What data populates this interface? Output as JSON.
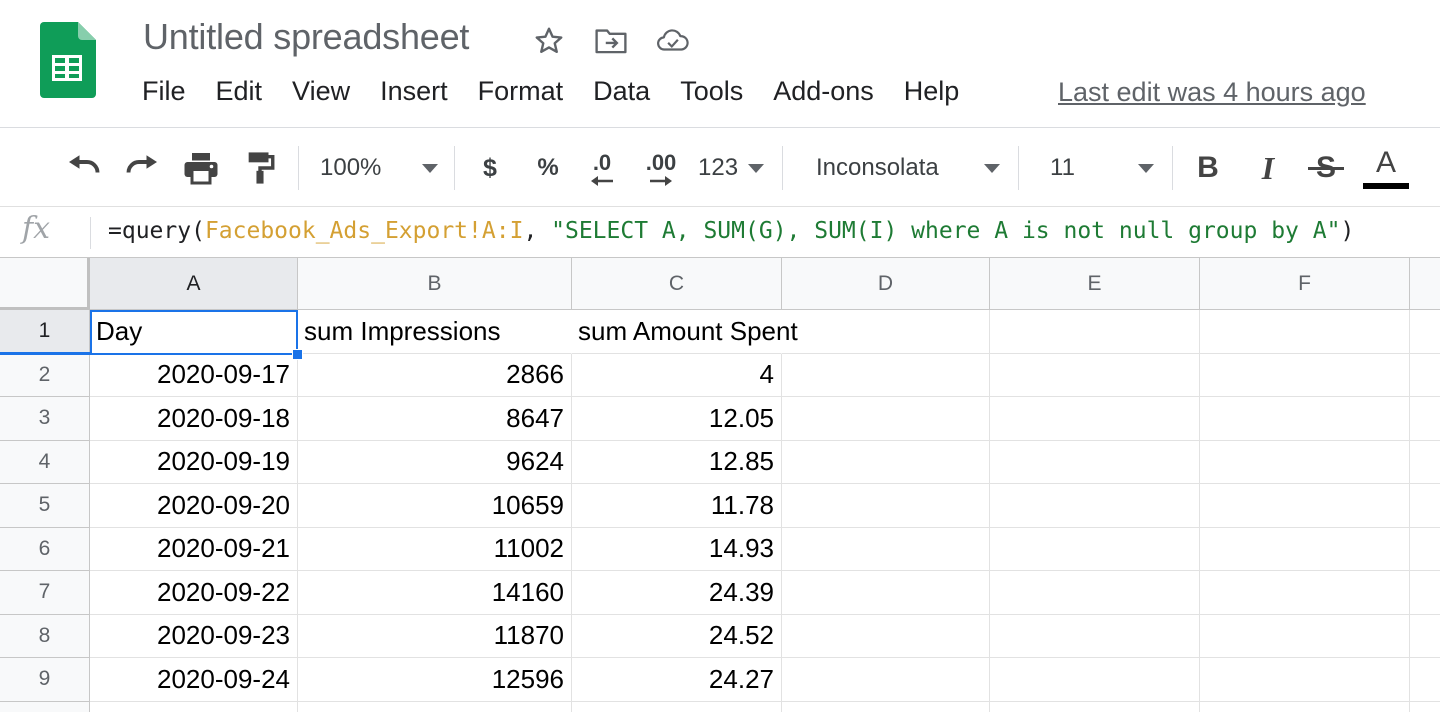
{
  "header": {
    "title": "Untitled spreadsheet",
    "icons": [
      "star-icon",
      "move-to-folder-icon",
      "cloud-status-icon"
    ],
    "menu": [
      "File",
      "Edit",
      "View",
      "Insert",
      "Format",
      "Data",
      "Tools",
      "Add-ons",
      "Help"
    ],
    "last_edit": "Last edit was 4 hours ago"
  },
  "toolbar": {
    "icons": [
      "undo-icon",
      "redo-icon",
      "print-icon",
      "paint-format-icon"
    ],
    "zoom": "100%",
    "currency": "$",
    "percent": "%",
    "decrease_decimal": ".0",
    "increase_decimal": ".00",
    "more_formats": "123",
    "font": "Inconsolata",
    "font_size": "11",
    "bold": "B",
    "italic": "I",
    "strikethrough": "S",
    "text_color": "A"
  },
  "formula_bar": {
    "fx": "fx",
    "prefix": "=query(",
    "range": "Facebook_Ads_Export!A:I",
    "sep": ", ",
    "string": "\"SELECT A, SUM(G), SUM(I) where A is not null group by A\"",
    "suffix": ")"
  },
  "grid": {
    "columns": [
      "A",
      "B",
      "C",
      "D",
      "E",
      "F"
    ],
    "selected_cell": "A1",
    "rows": [
      {
        "n": "1",
        "a": "Day",
        "b": "sum Impressions",
        "c": "sum Amount Spent"
      },
      {
        "n": "2",
        "a": "2020-09-17",
        "b": "2866",
        "c": "4"
      },
      {
        "n": "3",
        "a": "2020-09-18",
        "b": "8647",
        "c": "12.05"
      },
      {
        "n": "4",
        "a": "2020-09-19",
        "b": "9624",
        "c": "12.85"
      },
      {
        "n": "5",
        "a": "2020-09-20",
        "b": "10659",
        "c": "11.78"
      },
      {
        "n": "6",
        "a": "2020-09-21",
        "b": "11002",
        "c": "14.93"
      },
      {
        "n": "7",
        "a": "2020-09-22",
        "b": "14160",
        "c": "24.39"
      },
      {
        "n": "8",
        "a": "2020-09-23",
        "b": "11870",
        "c": "24.52"
      },
      {
        "n": "9",
        "a": "2020-09-24",
        "b": "12596",
        "c": "24.27"
      },
      {
        "n": "",
        "a": "",
        "b": "",
        "c": ""
      }
    ]
  },
  "colors": {
    "brand_green": "#0f9d58",
    "selection_blue": "#1a73e8",
    "formula_range": "#d4a033",
    "formula_string": "#1e7b34"
  }
}
